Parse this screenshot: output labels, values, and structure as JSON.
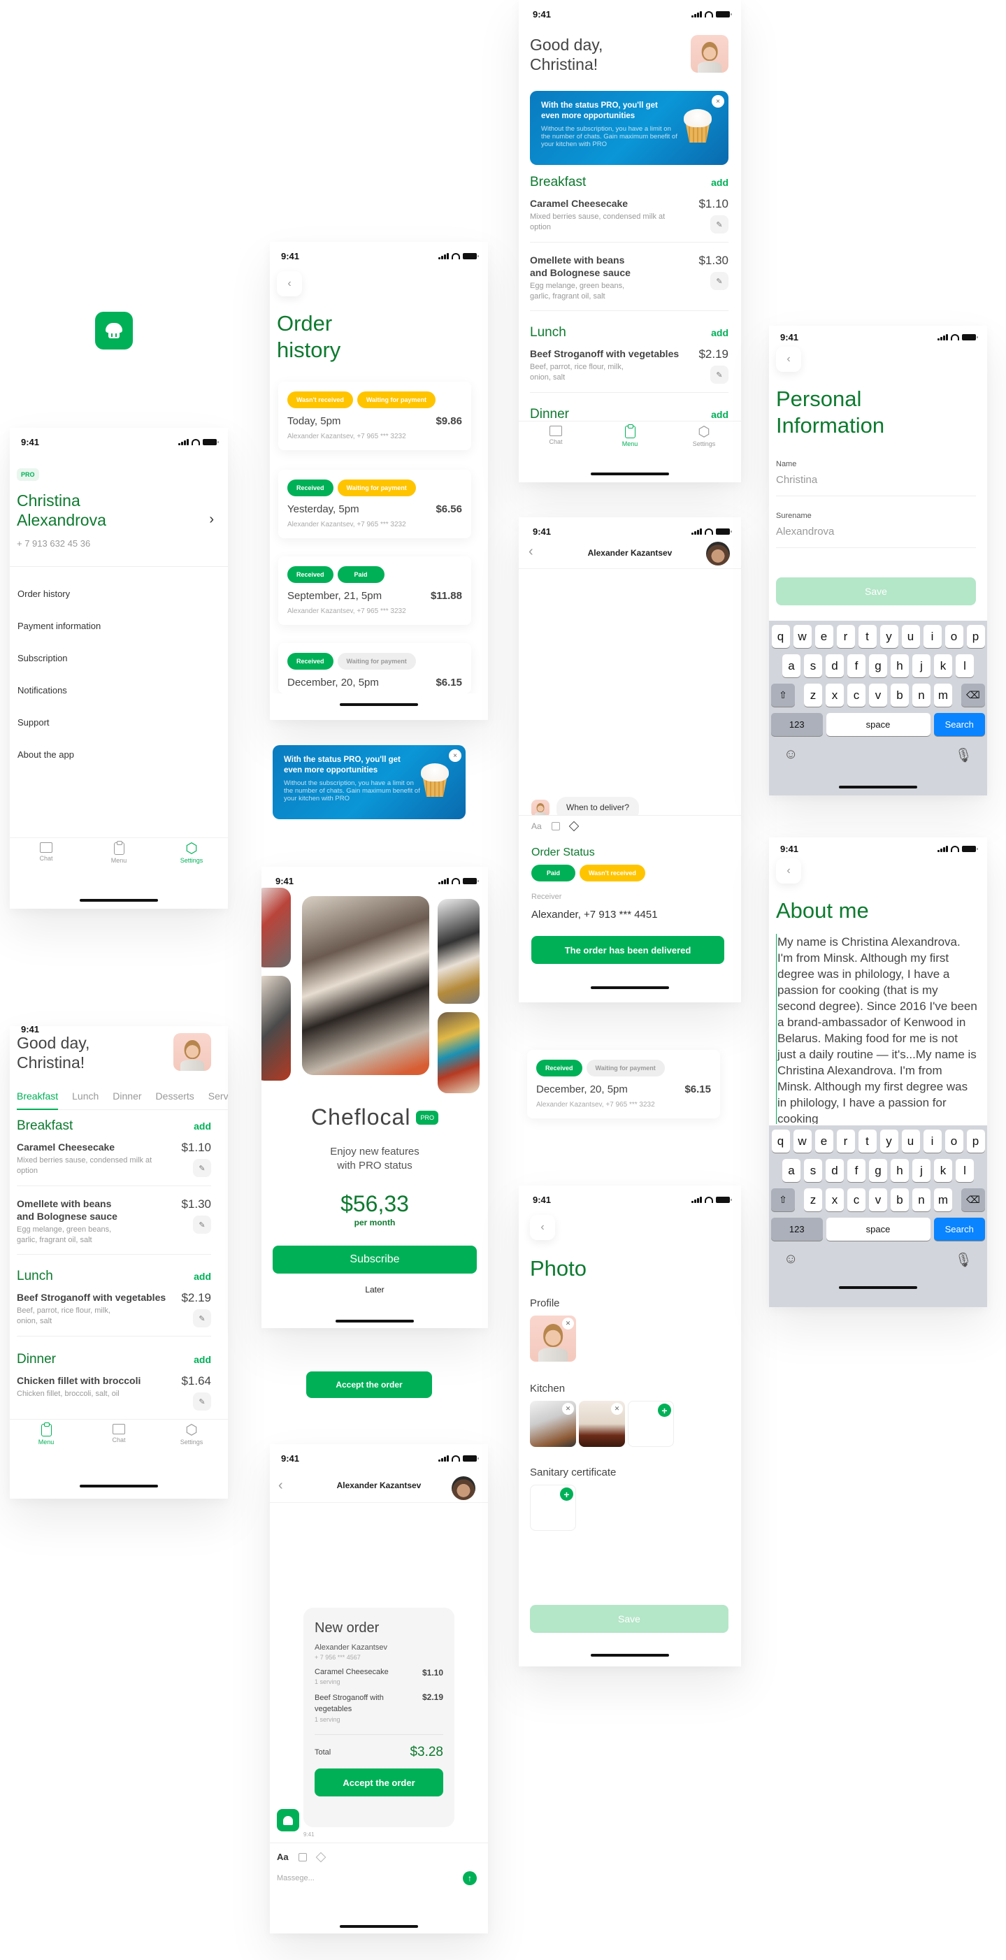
{
  "status": {
    "time": "9:41"
  },
  "colors": {
    "accent": "#00b057",
    "title_green": "#0d7a2f",
    "pending": "#ffc400",
    "promo_blue": "#0a8fd0",
    "keyboard_search": "#0a84ff"
  },
  "app_icon": {
    "icon": "chef-hat-icon"
  },
  "profile": {
    "badge": "PRO",
    "name": "Christina Alexandrova",
    "phone": "+ 7 913 632 45 36",
    "menu": [
      "Order history",
      "Payment information",
      "Subscription",
      "Notifications",
      "Support",
      "About the app"
    ],
    "tabs": [
      {
        "label": "Chat",
        "icon": "chat-icon"
      },
      {
        "label": "Menu",
        "icon": "clipboard-icon"
      },
      {
        "label": "Settings",
        "icon": "settings-icon",
        "active": true
      }
    ]
  },
  "order_history": {
    "title": "Order history",
    "orders": [
      {
        "statuses": [
          "Wasn't received",
          "Waiting for payment"
        ],
        "date": "Today, 5pm",
        "amount": "$9.86",
        "customer": "Alexander Kazantsev, +7 965 *** 3232"
      },
      {
        "statuses": [
          "Received",
          "Waiting for payment"
        ],
        "date": "Yesterday, 5pm",
        "amount": "$6.56",
        "customer": "Alexander Kazantsev, +7 965 *** 3232"
      },
      {
        "statuses": [
          "Received",
          "Paid"
        ],
        "date": "September, 21, 5pm",
        "amount": "$11.88",
        "customer": "Alexander Kazantsev, +7 965 *** 3232"
      },
      {
        "statuses": [
          "Received",
          "Waiting for payment"
        ],
        "date": "December, 20, 5pm",
        "amount": "$6.15",
        "customer": "Alexander Kazantsev, +7 965 *** 3232"
      }
    ]
  },
  "promo": {
    "title": "With the status PRO, you'll get even more opportunities",
    "body": "Without the subscription, you have a limit on the number of chats. Gain maximum benefit of your kitchen with PRO",
    "close": "×"
  },
  "menu_screen": {
    "greeting": "Good day, Christina!",
    "tabs": [
      "Breakfast",
      "Lunch",
      "Dinner",
      "Desserts",
      "Serv"
    ],
    "add_label": "add",
    "sections": [
      {
        "title": "Breakfast",
        "items": [
          {
            "name": "Caramel Cheesecake",
            "desc": "Mixed berries sause, condensed milk at option",
            "price": "$1.10"
          },
          {
            "name": "Omellete with beans and Bolognese sauce",
            "desc": "Egg melange, green beans, garlic, fragrant oil, salt",
            "price": "$1.30"
          }
        ]
      },
      {
        "title": "Lunch",
        "items": [
          {
            "name": "Beef Stroganoff with vegetables",
            "desc": "Beef, parrot, rice flour, milk, onion, salt",
            "price": "$2.19"
          }
        ]
      },
      {
        "title": "Dinner",
        "items": [
          {
            "name": "Chicken fillet with broccoli",
            "desc": "Chicken fillet, broccoli, salt, oil",
            "price": "$1.64"
          }
        ]
      }
    ],
    "tabs_bottom": [
      {
        "label": "Chat"
      },
      {
        "label": "Menu"
      },
      {
        "label": "Settings"
      }
    ],
    "tabs_bottom_alt": [
      {
        "label": "Menu"
      },
      {
        "label": "Chat"
      },
      {
        "label": "Settings"
      }
    ]
  },
  "chat": {
    "contact": "Alexander Kazantsev",
    "message": "When to deliver?",
    "input_tools": [
      "Aa",
      "image-icon",
      "box-icon"
    ],
    "order_status": {
      "title": "Order Status",
      "statuses": [
        "Paid",
        "Wasn't received"
      ],
      "receiver_label": "Receiver",
      "receiver": "Alexander, +7 913 *** 4451",
      "button": "The order has been delivered"
    },
    "new_order": {
      "title": "New order",
      "customer": "Alexander Kazantsev",
      "phone": "+ 7 956 *** 4567",
      "items": [
        {
          "name": "Caramel Cheesecake",
          "qty": "1 serving",
          "price": "$1.10"
        },
        {
          "name": "Beef Stroganoff with vegetables",
          "qty": "1 serving",
          "price": "$2.19"
        }
      ],
      "total_label": "Total",
      "total": "$3.28",
      "button": "Accept the order",
      "time": "9:41"
    },
    "input_placeholder": "Massege..."
  },
  "accept_button": "Accept the order",
  "subscription": {
    "brand": "Cheflocal",
    "badge": "PRO",
    "tagline": "Enjoy new features with PRO status",
    "price": "$56,33",
    "period": "per month",
    "subscribe": "Subscribe",
    "later": "Later"
  },
  "personal_info": {
    "title": "Personal Information",
    "fields": [
      {
        "label": "Name",
        "value": "Christina"
      },
      {
        "label": "Surename",
        "value": "Alexandrova"
      }
    ],
    "save": "Save"
  },
  "keyboard": {
    "rows": [
      [
        "q",
        "w",
        "e",
        "r",
        "t",
        "y",
        "u",
        "i",
        "o",
        "p"
      ],
      [
        "a",
        "s",
        "d",
        "f",
        "g",
        "h",
        "j",
        "k",
        "l"
      ],
      [
        "z",
        "x",
        "c",
        "v",
        "b",
        "n",
        "m"
      ]
    ],
    "num": "123",
    "space": "space",
    "search": "Search"
  },
  "about": {
    "title": "About me",
    "text": "My name is Christina Alexandrova. I'm from Minsk. Although my first degree was in philology, I have a passion for cooking (that is my second degree). Since 2016 I've been a brand-ambassador of Kenwood in Belarus. Making food for me is not just a daily routine — it's...My name is Christina Alexandrova. I'm from Minsk. Although my first degree was in philology, I have a passion for cooking"
  },
  "photo": {
    "title": "Photo",
    "sections": [
      "Profile",
      "Kitchen",
      "Sanitary certificate"
    ],
    "save": "Save"
  }
}
